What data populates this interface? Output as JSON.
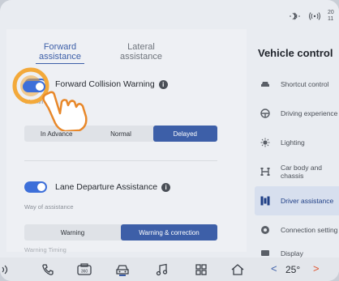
{
  "status": {
    "bluetooth_icon": "bluetooth-icon",
    "signal_icon": "wireless-signal-icon",
    "time_line1": "20",
    "time_line2": "11"
  },
  "tabs": [
    {
      "label_line1": "Forward",
      "label_line2": "assistance",
      "active": true
    },
    {
      "label_line1": "Lateral",
      "label_line2": "assistance",
      "active": false
    }
  ],
  "fcw": {
    "title": "Forward Collision Warning",
    "caption": "Warnin",
    "options": [
      "In Advance",
      "Normal",
      "Delayed"
    ],
    "selected": "Delayed",
    "enabled": true
  },
  "lda": {
    "title": "Lane Departure Assistance",
    "caption_assist": "Way of assistance",
    "options": [
      "Warning",
      "Warning & correction"
    ],
    "selected": "Warning & correction",
    "caption_timing": "Warning Timing",
    "enabled": true
  },
  "vehicle_control": {
    "title": "Vehicle control",
    "items": [
      {
        "label": "Shortcut control",
        "icon": "car-icon"
      },
      {
        "label": "Driving experience",
        "icon": "steering-wheel-icon"
      },
      {
        "label": "Lighting",
        "icon": "light-icon"
      },
      {
        "label": "Car body and",
        "label2": "chassis",
        "icon": "chassis-icon"
      },
      {
        "label": "Driver assistance",
        "icon": "driver-assistance-icon",
        "active": true
      },
      {
        "label": "Connection setting",
        "icon": "connection-icon"
      },
      {
        "label": "Display",
        "icon": "display-icon"
      }
    ]
  },
  "bottombar": {
    "temperature": "25°",
    "prev": "<",
    "next": ">"
  },
  "colors": {
    "accent": "#3d5fa8",
    "toggle": "#3d6fd9",
    "hand_ring": "#f3a93a",
    "next_chevron": "#e0532f"
  }
}
